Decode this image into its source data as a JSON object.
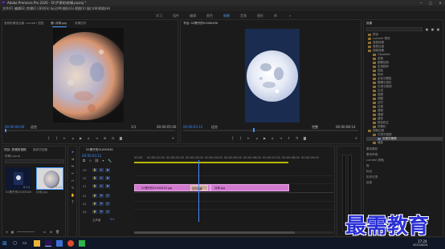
{
  "window": {
    "title": "Adobe Premiere Pro 2020 - D:\\严肃的\\剪辑.prproj *",
    "minimize": "—",
    "maximize": "□",
    "close": "✕"
  },
  "menu": [
    "文件(F)",
    "编辑(E)",
    "剪辑(C)",
    "序列(S)",
    "标记(M)",
    "图形(G)",
    "视图(V)",
    "窗口(W)",
    "帮助(H)"
  ],
  "workspaces": [
    "学习",
    "组件",
    "编辑",
    "颜色",
    "效果",
    "音频",
    "图形",
    "库",
    "»"
  ],
  "active_workspace": "效果",
  "source_monitor": {
    "tabs": [
      "音频剪辑混合器",
      "Lumetri 范围",
      "源: 月球.jpg",
      "效果控件",
      "音频剪辑混合器: 02黑开的01000430"
    ],
    "active_tab": "源: 月球.jpg",
    "timecode_in": "00:00:00:00",
    "fit": "适合",
    "scale": "1/1",
    "timecode_out": "00:00:05:00"
  },
  "program_monitor": {
    "title": "节目: 02黑开的01000430",
    "timecode_in": "00:00:03:12",
    "fit": "适合",
    "scale": "完整",
    "timecode_out": "00:00:08:14"
  },
  "effects_panel": {
    "title": "效果",
    "items": [
      "预设",
      "Lumetri 预设",
      "音频效果",
      "音频过渡",
      "视频效果",
      "Obsolete",
      "变换",
      "图像控制",
      "实用程序",
      "扭曲",
      "时间",
      "杂色与颗粒",
      "模糊与锐化",
      "沉浸式视频",
      "生成",
      "视频",
      "调整",
      "过时",
      "过渡",
      "透视",
      "通道",
      "键控",
      "颜色校正",
      "风格化",
      "视频过渡",
      "3D 运动",
      "Dissolve",
      "内滑",
      "划像",
      "擦除",
      "沉浸式视频",
      "溶解",
      "缩放",
      "页面剥落"
    ],
    "sub_panels": [
      "基本图形",
      "基本声音",
      "Lumetri 颜色",
      "库",
      "标记",
      "历史记录",
      "信息"
    ]
  },
  "project_panel": {
    "tabs": [
      "项目: 剪辑的视频",
      "媒体浏览器"
    ],
    "filename": "剪辑.prproj",
    "clips": [
      {
        "name": "02黑开的01000430",
        "duration": "8:14"
      },
      {
        "name": "月球.jpg",
        "duration": "5:00"
      }
    ]
  },
  "timeline": {
    "title": "02黑开的01000430",
    "timecode": "00:00:03:12",
    "ruler": [
      "00:00",
      "00:00:01:00",
      "00:00:02:00",
      "00:00:03:00",
      "00:00:04:00",
      "00:00:05:00",
      "00:00:06:00",
      "00:00:07:00",
      "00:00:08:00",
      "00:00:09:00"
    ],
    "video_tracks": [
      "V3",
      "V2",
      "V1"
    ],
    "audio_tracks": [
      "A1",
      "A2",
      "A3"
    ],
    "master": "主声道",
    "master_value": "0.0",
    "clips": [
      {
        "name": "02黑开的01000430.jpg"
      },
      {
        "name": "交叉溶解"
      },
      {
        "name": "月球.jpg"
      }
    ]
  },
  "taskbar": {
    "time": "17:24",
    "date": "2021/6/24"
  },
  "watermark": "最需教育",
  "colors": {
    "accent_blue": "#3d8bff",
    "clip_pink": "#d27ad0",
    "transition": "#c9a59a",
    "playhead": "#4a8dff"
  }
}
